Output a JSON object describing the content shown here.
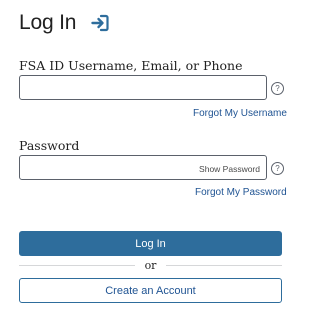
{
  "header": {
    "title": "Log In",
    "icon": "login-arrow-icon",
    "icon_color": "#2e6d9c"
  },
  "username_field": {
    "label": "FSA ID Username, Email, or Phone",
    "value": "",
    "help_icon": "question-circle-icon",
    "help_glyph": "?",
    "forgot_link": "Forgot My Username"
  },
  "password_field": {
    "label": "Password",
    "value": "",
    "show_password_label": "Show Password",
    "help_icon": "question-circle-icon",
    "help_glyph": "?",
    "forgot_link": "Forgot My Password"
  },
  "actions": {
    "login_label": "Log In",
    "divider_text": "or",
    "create_account_label": "Create an Account"
  },
  "colors": {
    "primary": "#2e6d9c",
    "link": "#205493",
    "text": "#212121",
    "border": "#5b616b"
  }
}
